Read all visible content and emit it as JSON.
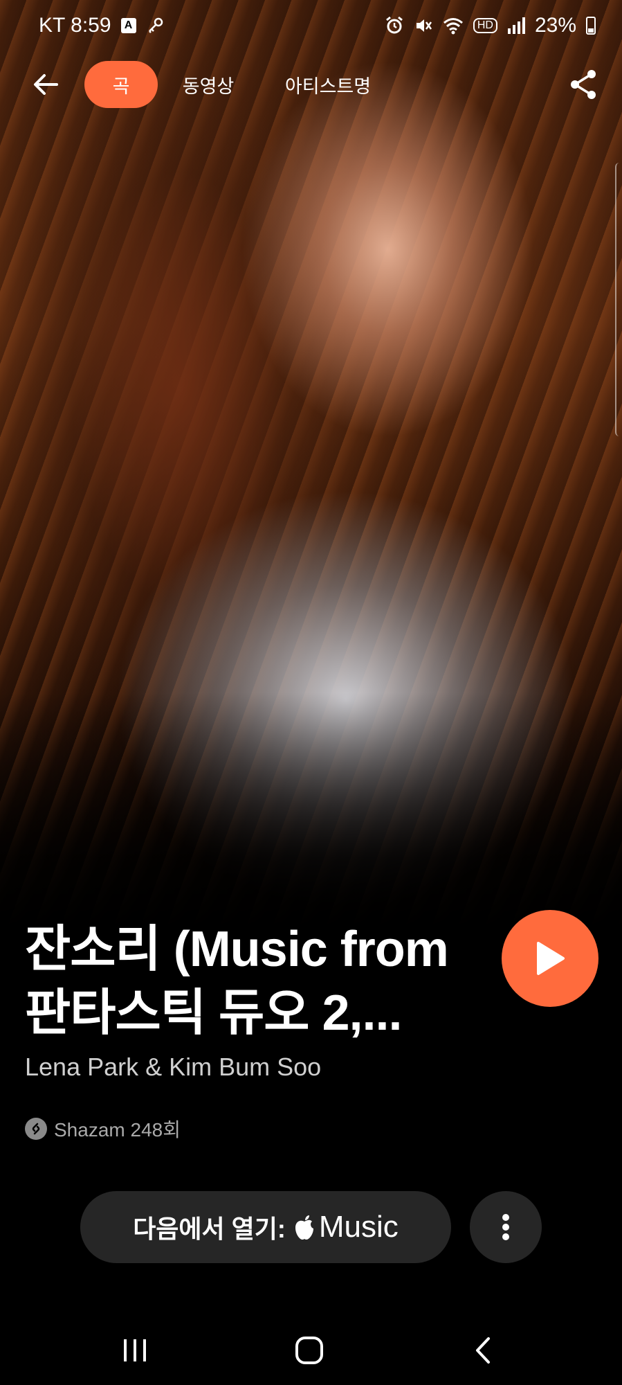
{
  "status_bar": {
    "carrier_time": "KT 8:59",
    "battery_percent": "23%",
    "icons": [
      "a-badge-icon",
      "key-icon",
      "alarm-icon",
      "mute-icon",
      "wifi-icon",
      "hd-icon",
      "signal-icon",
      "battery-icon"
    ]
  },
  "nav": {
    "tabs": [
      {
        "label": "곡",
        "active": true
      },
      {
        "label": "동영상",
        "active": false
      },
      {
        "label": "아티스트명",
        "active": false
      }
    ],
    "back_icon": "arrow-left-icon",
    "share_icon": "share-icon"
  },
  "track": {
    "title_line1": "잔소리 (Music from",
    "title_line2": "판타스틱 듀오 2,...",
    "artist": "Lena Park & Kim Bum Soo",
    "shazam_count": "Shazam 248회"
  },
  "actions": {
    "open_in_label": "다음에서 열기:",
    "open_in_service": "Music",
    "play_icon": "play-icon",
    "more_icon": "more-vertical-icon"
  },
  "colors": {
    "accent": "#ff6b3d",
    "button_bg": "#262626",
    "background": "#000000"
  }
}
